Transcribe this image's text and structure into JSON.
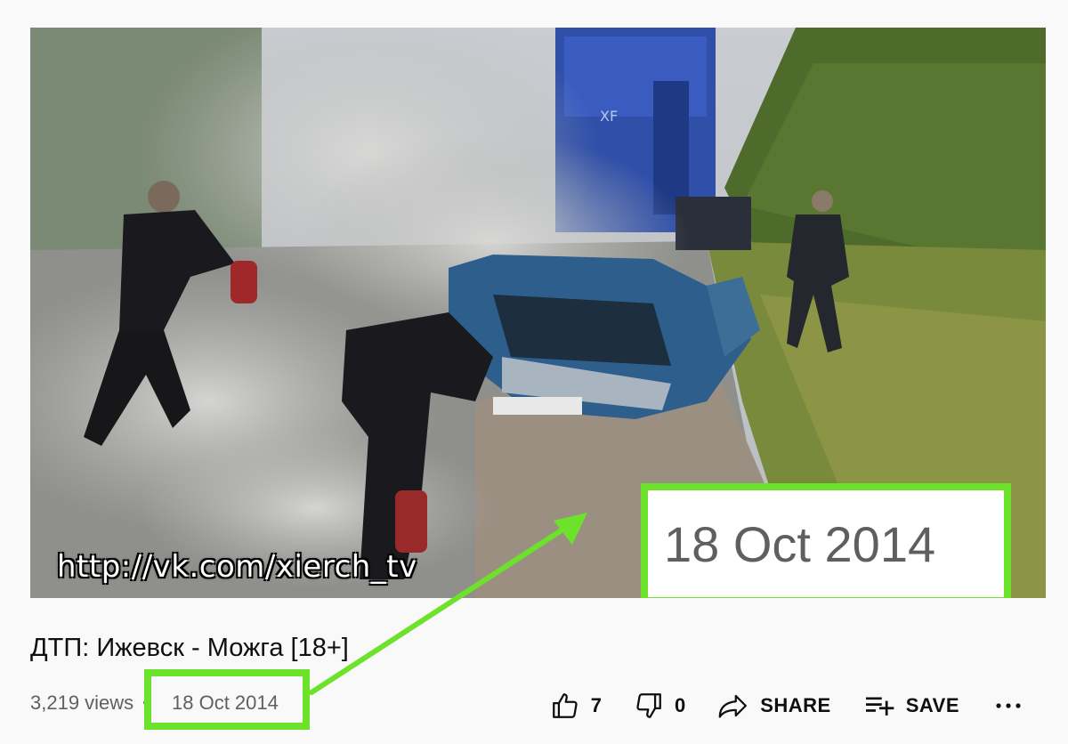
{
  "video": {
    "watermark": "http://vk.com/xierch_tv",
    "callout_date": "18 Oct 2014",
    "highlight_color": "#6de22a"
  },
  "title": "ДТП: Ижевск - Можга [18+]",
  "meta": {
    "views": "3,219 views",
    "separator": "•",
    "date": "18 Oct 2014"
  },
  "actions": {
    "like": {
      "icon": "thumbs-up-icon",
      "count": "7"
    },
    "dislike": {
      "icon": "thumbs-down-icon",
      "count": "0"
    },
    "share": {
      "icon": "share-arrow-icon",
      "label": "SHARE"
    },
    "save": {
      "icon": "playlist-add-icon",
      "label": "SAVE"
    },
    "more": {
      "icon": "more-horizontal-icon",
      "label": "•••"
    }
  }
}
